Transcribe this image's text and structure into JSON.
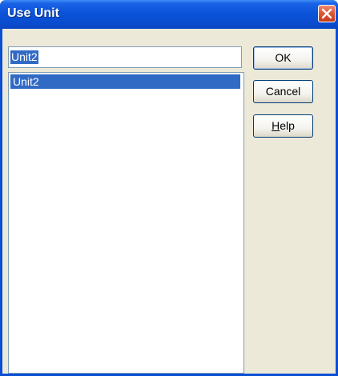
{
  "window": {
    "title": "Use Unit"
  },
  "unit_field": {
    "value": "Unit2"
  },
  "unit_list": {
    "items": [
      {
        "label": "Unit2",
        "selected": true
      }
    ]
  },
  "buttons": {
    "ok_label": "OK",
    "cancel_label": "Cancel",
    "help_mnemonic": "H",
    "help_rest": "elp"
  },
  "icons": {
    "close": "close-icon"
  },
  "colors": {
    "title_bar": "#0a4fd4",
    "selection": "#316ac5",
    "dialog_face": "#ece9d8",
    "close_button": "#dc5a3a"
  }
}
